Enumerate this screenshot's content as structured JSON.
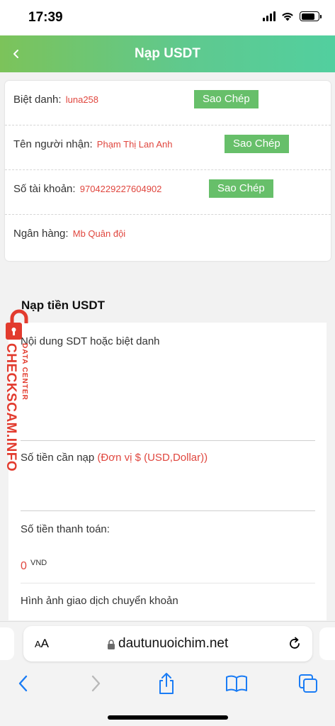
{
  "status": {
    "time": "17:39"
  },
  "header": {
    "title": "Nạp USDT",
    "back_icon": "chevron-left-icon"
  },
  "info": {
    "rows": [
      {
        "label": "Biệt danh:",
        "value": "luna258",
        "button": "Sao Chép"
      },
      {
        "label": "Tên người nhận:",
        "value": "Phạm Thị Lan Anh",
        "button": "Sao Chép"
      },
      {
        "label": "Số tài khoản:",
        "value": "9704229227604902",
        "button": "Sao Chép"
      },
      {
        "label": "Ngân hàng:",
        "value": "Mb Quân đội"
      }
    ]
  },
  "form": {
    "title": "Nạp tiền USDT",
    "content_label": "Nội dung SDT hoặc biệt danh",
    "amount_label": "Số tiền cần nạp",
    "amount_hint": "(Đơn vị $ (USD,Dollar))",
    "payment_label": "Số tiền thanh toán:",
    "payment_value": "0",
    "payment_unit": "VND",
    "image_label": "Hình ảnh giao dịch chuyển khoản"
  },
  "watermark": {
    "main": "CHECKSCAM.INFO",
    "sub": "DATA CENTER"
  },
  "browser": {
    "aa": "AA",
    "url": "dautunuoichim.net"
  },
  "colors": {
    "header_start": "#7cc35a",
    "header_end": "#52cf9f",
    "copy_button": "#67bf6a",
    "value_red": "#e0463e",
    "ios_blue": "#1a7cf5"
  }
}
